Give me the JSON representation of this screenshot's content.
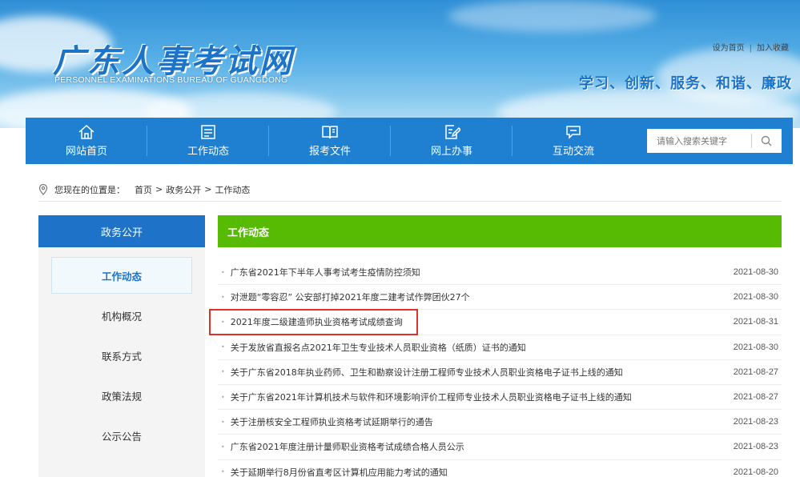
{
  "header": {
    "logo_title": "广东人事考试网",
    "logo_subtitle": "PERSONNEL EXAMINATIONS BUREAU OF GUANGDONG",
    "top_links": [
      "设为首页",
      "|",
      "加入收藏"
    ],
    "slogan": "学习、创新、服务、和谐、廉政"
  },
  "nav": {
    "items": [
      {
        "label": "网站首页",
        "icon": "home-icon"
      },
      {
        "label": "工作动态",
        "icon": "news-icon"
      },
      {
        "label": "报考文件",
        "icon": "book-icon"
      },
      {
        "label": "网上办事",
        "icon": "edit-icon"
      },
      {
        "label": "互动交流",
        "icon": "chat-icon"
      }
    ],
    "search_placeholder": "请输入搜索关键字"
  },
  "breadcrumb": {
    "prefix": "您现在的位置是：",
    "items": [
      "首页",
      ">",
      "政务公开",
      ">",
      "工作动态"
    ]
  },
  "sidebar": {
    "title": "政务公开",
    "items": [
      {
        "label": "工作动态",
        "active": true
      },
      {
        "label": "机构概况",
        "active": false
      },
      {
        "label": "联系方式",
        "active": false
      },
      {
        "label": "政策法规",
        "active": false
      },
      {
        "label": "公示公告",
        "active": false
      },
      {
        "label": "",
        "active": false
      }
    ]
  },
  "main": {
    "title": "工作动态",
    "rows": [
      {
        "title": "广东省2021年下半年人事考试考生疫情防控须知",
        "date": "2021-08-30"
      },
      {
        "title": "对泄题“零容忍” 公安部打掉2021年度二建考试作弊团伙27个",
        "date": "2021-08-30"
      },
      {
        "title": "2021年度二级建造师执业资格考试成绩查询",
        "date": "2021-08-31"
      },
      {
        "title": "关于发放省直报名点2021年卫生专业技术人员职业资格（纸质）证书的通知",
        "date": "2021-08-30"
      },
      {
        "title": "关于广东省2018年执业药师、卫生和勘察设计注册工程师专业技术人员职业资格电子证书上线的通知",
        "date": "2021-08-27"
      },
      {
        "title": "关于广东省2021年计算机技术与软件和环境影响评价工程师专业技术人员职业资格电子证书上线的通知",
        "date": "2021-08-27"
      },
      {
        "title": "关于注册核安全工程师执业资格考试延期举行的通告",
        "date": "2021-08-23"
      },
      {
        "title": "广东省2021年度注册计量师职业资格考试成绩合格人员公示",
        "date": "2021-08-23"
      },
      {
        "title": "关于延期举行8月份省直考区计算机应用能力考试的通知",
        "date": "2021-08-20"
      }
    ]
  },
  "colors": {
    "nav_blue": "#1f7fd0",
    "sidebar_blue": "#1e72c7",
    "main_green": "#57bb04",
    "highlight_red": "#e0302c"
  }
}
